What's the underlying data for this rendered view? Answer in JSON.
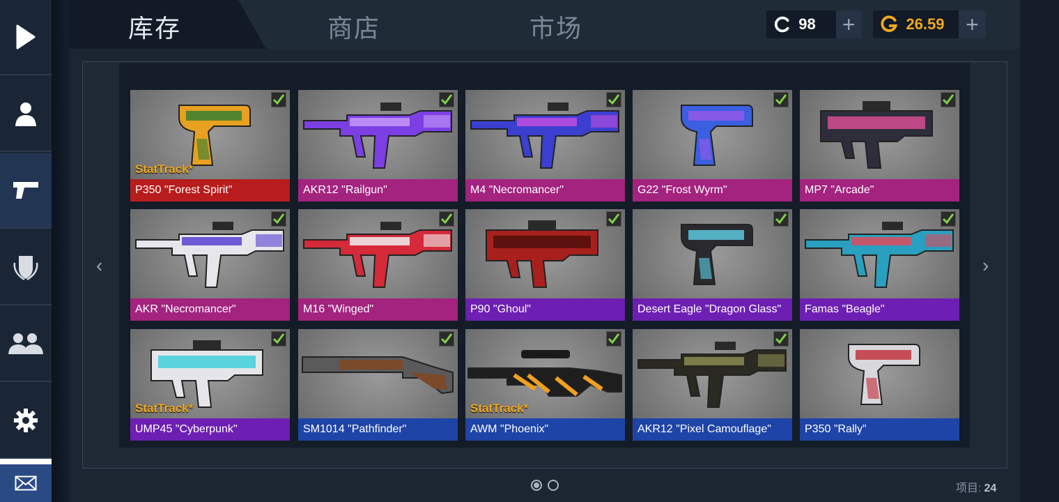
{
  "tabs": [
    {
      "label": "库存",
      "active": true
    },
    {
      "label": "商店",
      "active": false
    },
    {
      "label": "市场",
      "active": false
    }
  ],
  "currencies": [
    {
      "name": "credits",
      "value": "98",
      "icon": "c-coin-icon",
      "color": "#ffffff"
    },
    {
      "name": "gold",
      "value": "26.59",
      "icon": "g-coin-icon",
      "color": "#f0a91d"
    }
  ],
  "sidebar": [
    {
      "name": "play",
      "icon": "play-icon"
    },
    {
      "name": "profile",
      "icon": "profile-icon"
    },
    {
      "name": "inventory",
      "icon": "pistol-icon",
      "active": true
    },
    {
      "name": "clan",
      "icon": "shield-icon"
    },
    {
      "name": "friends",
      "icon": "friends-icon"
    },
    {
      "name": "settings",
      "icon": "gear-icon"
    },
    {
      "name": "mail",
      "icon": "mail-icon"
    }
  ],
  "items": [
    {
      "name": "P350 \"Forest Spirit\"",
      "rarity_color": "#b91c1c",
      "stattrack": true,
      "art": "pistol",
      "c1": "#e8a020",
      "c2": "#2e7d32"
    },
    {
      "name": "AKR12 \"Railgun\"",
      "rarity_color": "#a3237f",
      "stattrack": false,
      "art": "rifle",
      "c1": "#7b3fe4",
      "c2": "#c59af7"
    },
    {
      "name": "M4 \"Necromancer\"",
      "rarity_color": "#a3237f",
      "stattrack": false,
      "art": "rifle",
      "c1": "#3a3fd0",
      "c2": "#c34fe0"
    },
    {
      "name": "G22 \"Frost Wyrm\"",
      "rarity_color": "#a3237f",
      "stattrack": false,
      "art": "pistol",
      "c1": "#3a5fe0",
      "c2": "#9a58e8"
    },
    {
      "name": "MP7 \"Arcade\"",
      "rarity_color": "#a3237f",
      "stattrack": false,
      "art": "smg",
      "c1": "#2e2e3a",
      "c2": "#e0509a"
    },
    {
      "name": "AKR \"Necromancer\"",
      "rarity_color": "#a3237f",
      "stattrack": false,
      "art": "rifle",
      "c1": "#e6e6ec",
      "c2": "#5a3fd0"
    },
    {
      "name": "M16 \"Winged\"",
      "rarity_color": "#a3237f",
      "stattrack": false,
      "art": "rifle",
      "c1": "#d42a3a",
      "c2": "#f0f0f0"
    },
    {
      "name": "P90 \"Ghoul\"",
      "rarity_color": "#6d1fb3",
      "stattrack": false,
      "art": "smg",
      "c1": "#a8201c",
      "c2": "#4a0f0c"
    },
    {
      "name": "Desert Eagle \"Dragon Glass\"",
      "rarity_color": "#6d1fb3",
      "stattrack": false,
      "art": "pistol",
      "c1": "#2a2a2e",
      "c2": "#5fd2e8"
    },
    {
      "name": "Famas \"Beagle\"",
      "rarity_color": "#6d1fb3",
      "stattrack": false,
      "art": "rifle",
      "c1": "#2aa0c0",
      "c2": "#e04a5a"
    },
    {
      "name": "UMP45 \"Cyberpunk\"",
      "rarity_color": "#6d1fb3",
      "stattrack": true,
      "art": "smg",
      "c1": "#e6e6ea",
      "c2": "#36d0d8"
    },
    {
      "name": "SM1014 \"Pathfinder\"",
      "rarity_color": "#1f44a8",
      "stattrack": false,
      "art": "shotgun",
      "c1": "#7a4a2a",
      "c2": "#5a5a5a"
    },
    {
      "name": "AWM \"Phoenix\"",
      "rarity_color": "#1f44a8",
      "stattrack": true,
      "art": "sniper",
      "c1": "#1e1e1e",
      "c2": "#f0a020"
    },
    {
      "name": "AKR12 \"Pixel Camouflage\"",
      "rarity_color": "#1f44a8",
      "stattrack": false,
      "art": "rifle",
      "c1": "#2a2a22",
      "c2": "#8a8a52"
    },
    {
      "name": "P350 \"Rally\"",
      "rarity_color": "#1f44a8",
      "stattrack": false,
      "art": "pistol",
      "c1": "#d8d8dc",
      "c2": "#c22a34"
    }
  ],
  "stattrack_label": "StatTrack*",
  "pager": {
    "left_arrow": "‹",
    "right_arrow": "›",
    "pages": 2,
    "current": 1
  },
  "count": {
    "label": "项目:",
    "value": "24"
  }
}
